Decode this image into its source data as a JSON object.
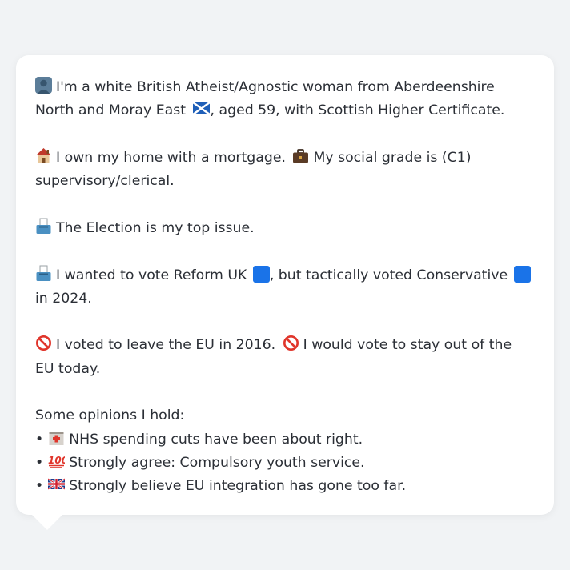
{
  "profile": {
    "intro_text": "I'm a white British Atheist/Agnostic woman from Aberdeenshire North and Moray East",
    "intro_text_2": ", aged 59, with Scottish Higher Certificate.",
    "home_text": "I own my home with a mortgage.",
    "grade_text": "My social grade is (C1) supervisory/clerical.",
    "issue_text": "The Election is my top issue.",
    "vote_text_1": "I wanted to vote Reform UK",
    "vote_text_2": ", but tactically voted Conservative",
    "vote_text_3": " in 2024.",
    "eu_text_1": "I voted to leave the EU in 2016.",
    "eu_text_2": "I would vote to stay out of the EU today.",
    "opinions_heading": "Some opinions I hold:",
    "opinions": [
      {
        "bullet": "•",
        "text": "NHS spending cuts have been about right."
      },
      {
        "bullet": "•",
        "text": "Strongly agree: Compulsory youth service."
      },
      {
        "bullet": "•",
        "text": "Strongly believe EU integration has gone too far."
      }
    ],
    "party_colors": {
      "reform": "#1a73e8",
      "conservative": "#1a73e8"
    },
    "icons": [
      "person-icon",
      "scotland-flag-icon",
      "house-icon",
      "briefcase-icon",
      "ballot-box-icon",
      "ballot-box-icon",
      "reform-square-icon",
      "conservative-square-icon",
      "prohibited-icon",
      "prohibited-icon",
      "hospital-icon",
      "hundred-points-icon",
      "uk-flag-icon"
    ]
  }
}
